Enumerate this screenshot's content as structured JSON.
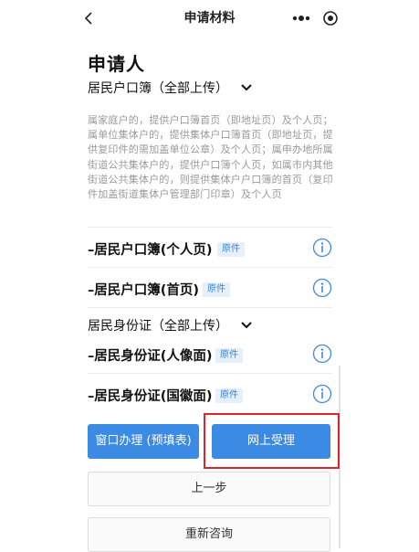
{
  "nav": {
    "title": "申请材料",
    "back_icon": "chevron-left-icon",
    "more_icon": "more-dots-icon",
    "target_icon": "target-icon"
  },
  "section": {
    "title": "申请人"
  },
  "household": {
    "group_label": "居民户口簿（全部上传）",
    "description": "属家庭户的，提供户口簿首页（即地址页）及个人页；属单位集体户的，提供集体户口簿首页（即地址页，提供复印件的需加盖单位公章）及个人页；属申办地所属街道公共集体户的，提供户口簿个人页，如属市内其他街道公共集体户的，则提供集体户户口簿的首页（复印件加盖街道集体户管理部门印章）及个人页",
    "items": [
      {
        "name": "–居民户口簿(个人页)",
        "tag": "原件"
      },
      {
        "name": "–居民户口簿(首页)",
        "tag": "原件"
      }
    ]
  },
  "idcard": {
    "group_label": "居民身份证（全部上传）",
    "items": [
      {
        "name": "–居民身份证(人像面)",
        "tag": "原件"
      },
      {
        "name": "–居民身份证(国徽面)",
        "tag": "原件"
      }
    ]
  },
  "buttons": {
    "window": "窗口办理 (预填表)",
    "online": "网上受理",
    "prev": "上一步",
    "reconsult": "重新咨询"
  },
  "colors": {
    "primary": "#3b8ae4",
    "highlight": "#d9252e",
    "tag_text": "#3a84d8",
    "tag_bg": "#e6f0fb"
  }
}
